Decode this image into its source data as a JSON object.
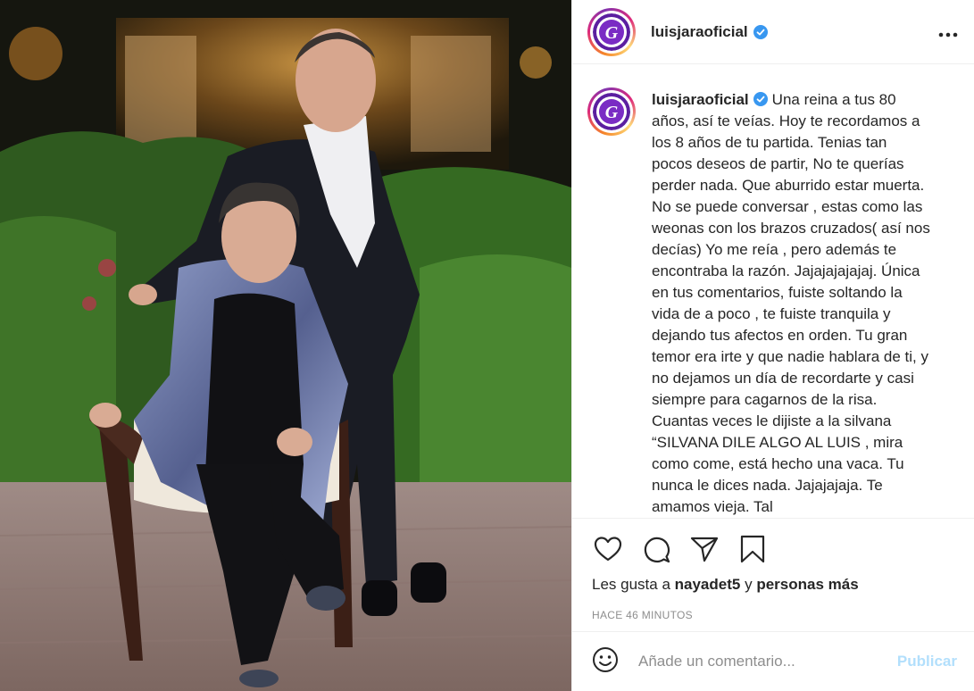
{
  "post": {
    "username": "luisjaraoficial",
    "verified": true,
    "caption": "Una reina a tus 80 años, así te veías. Hoy te recordamos a los 8 años de tu partida. Tenias tan pocos deseos de partir, No te querías perder nada. Que aburrido estar muerta. No se puede conversar , estas como las weonas con los brazos cruzados( así nos decías) Yo me reía , pero además te encontraba la razón. Jajajajajajaj. Única en tus comentarios, fuiste soltando la vida de a poco , te fuiste tranquila y dejando tus afectos en orden. Tu gran temor era irte y que nadie hablara de ti, y no dejamos un día de recordarte y casi siempre para cagarnos de la risa. Cuantas veces le dijiste a la silvana “SILVANA DILE ALGO AL LUIS , mira como come, está hecho una vaca. Tu nunca le dices nada. Jajajajaja. Te amamos vieja. Tal",
    "likes": {
      "prefix": "Les gusta a",
      "user": "nayadet5",
      "conjunction": "y",
      "others": "personas más"
    },
    "timestamp": "HACE 46 MINUTOS"
  },
  "comment": {
    "placeholder": "Añade un comentario...",
    "publish_label": "Publicar"
  },
  "icons": {
    "more": "more-options-icon",
    "like": "heart-icon",
    "comment": "comment-icon",
    "share": "share-icon",
    "save": "bookmark-icon",
    "emoji": "emoji-icon",
    "verified": "verified-badge-icon"
  },
  "colors": {
    "verified": "#3897f0",
    "publish_disabled": "#b2dffc",
    "muted_text": "#8e8e8e",
    "logo_purple": "#5b1fa0"
  }
}
